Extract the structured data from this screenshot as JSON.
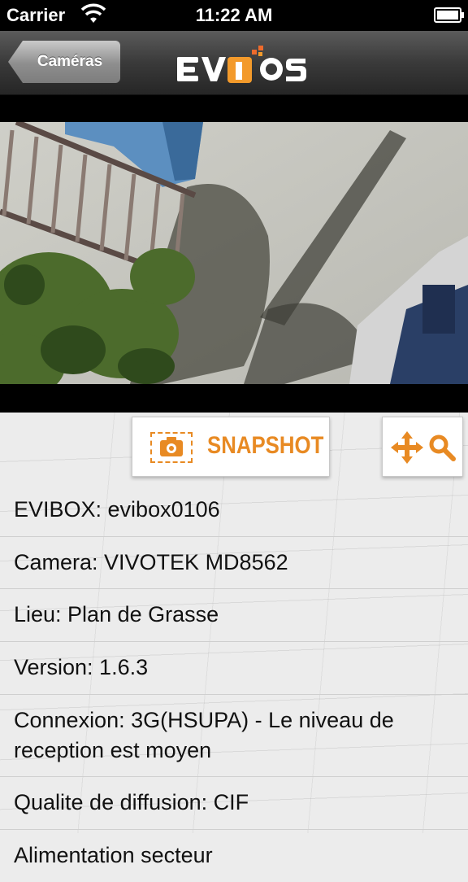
{
  "status_bar": {
    "carrier": "Carrier",
    "time": "11:22 AM",
    "battery_level": 1.0
  },
  "nav_bar": {
    "back_label": "Caméras",
    "logo_text": "EVIOS",
    "colors": {
      "logo_accent": "#f39a2b",
      "logo_dots": "#ee6b2c"
    }
  },
  "snapshot_button": {
    "label": "SNAPSHOT",
    "icon": "camera-icon"
  },
  "ptz_button": {
    "icons": [
      "move-arrows-icon",
      "magnifier-icon"
    ]
  },
  "info": {
    "evibox": "EVIBOX: evibox0106",
    "camera": "Camera: VIVOTEK MD8562",
    "lieu": "Lieu: Plan de Grasse",
    "version": "Version: 1.6.3",
    "connexion": "Connexion: 3G(HSUPA) - Le niveau de reception est moyen",
    "qualite": "Qualite de diffusion: CIF",
    "alimentation": "Alimentation secteur"
  },
  "colors": {
    "accent": "#e88a23",
    "panel_bg": "#ececec"
  }
}
